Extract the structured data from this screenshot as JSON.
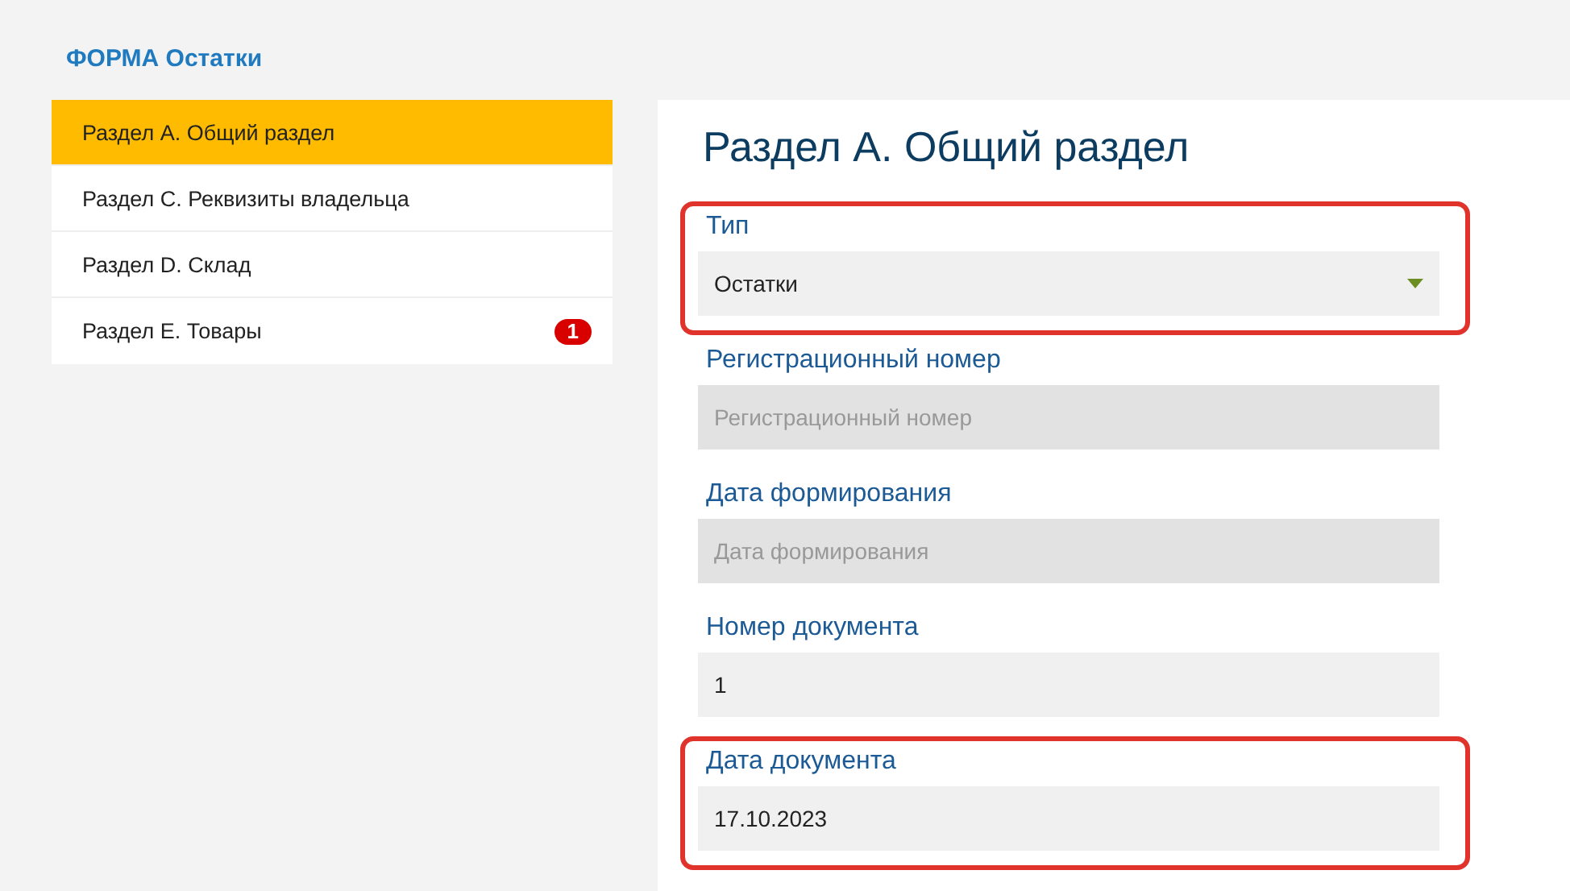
{
  "form_title": "ФОРМА Остатки",
  "sidebar": {
    "items": [
      {
        "label": "Раздел А. Общий раздел",
        "selected": true
      },
      {
        "label": "Раздел С. Реквизиты владельца",
        "selected": false
      },
      {
        "label": "Раздел D. Склад",
        "selected": false
      },
      {
        "label": "Раздел Е. Товары",
        "selected": false,
        "badge": "1"
      }
    ]
  },
  "section": {
    "title": "Раздел А. Общий раздел",
    "fields": [
      {
        "kind": "select",
        "label": "Тип",
        "value": "Остатки",
        "disabled": false,
        "highlighted": true
      },
      {
        "kind": "input",
        "label": "Регистрационный номер",
        "placeholder": "Регистрационный номер",
        "disabled": true,
        "highlighted": false
      },
      {
        "kind": "input",
        "label": "Дата формирования",
        "placeholder": "Дата формирования",
        "disabled": true,
        "highlighted": false
      },
      {
        "kind": "input",
        "label": "Номер документа",
        "value": "1",
        "disabled": false,
        "highlighted": false
      },
      {
        "kind": "input",
        "label": "Дата документа",
        "value": "17.10.2023",
        "disabled": false,
        "highlighted": true
      }
    ]
  }
}
